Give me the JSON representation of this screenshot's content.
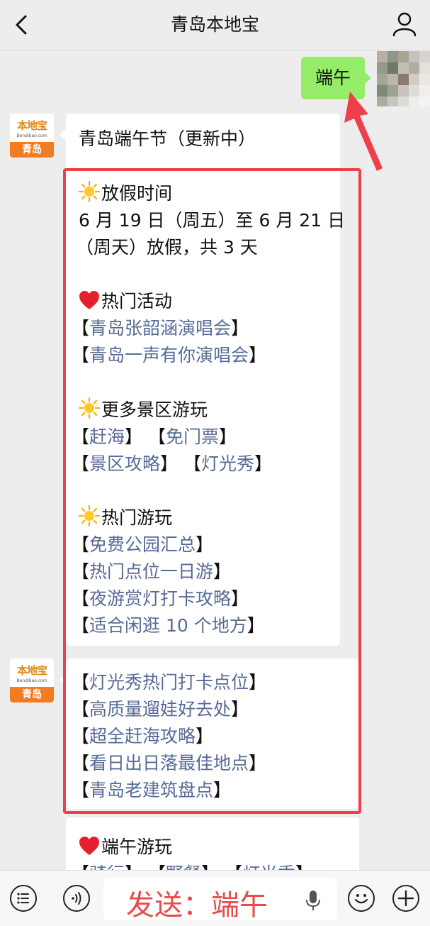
{
  "header": {
    "title": "青岛本地宝"
  },
  "sent_message": {
    "text": "端午"
  },
  "account": {
    "brand": "本地宝",
    "url": "Bendibao.com",
    "city": "青岛"
  },
  "message1": {
    "title": "青岛端午节（更新中）",
    "holiday_heading": "放假时间",
    "holiday_line1": "6 月 19 日（周五）至 6 月 21 日",
    "holiday_line2": "（周天）放假，共 3 天",
    "hot_events_heading": "热门活动",
    "hot_events": [
      "青岛张韶涵演唱会",
      "青岛一声有你演唱会"
    ],
    "scenic_heading": "更多景区游玩",
    "scenic_row1": [
      "赶海",
      "免门票"
    ],
    "scenic_row2": [
      "景区攻略",
      "灯光秀"
    ],
    "hot_play_heading": "热门游玩",
    "hot_play": [
      "免费公园汇总",
      "热门点位一日游",
      "夜游赏灯打卡攻略",
      "适合闲逛 10 个地方"
    ]
  },
  "message2": {
    "links": [
      "灯光秀热门打卡点位",
      "高质量遛娃好去处",
      "超全赶海攻略",
      "看日出日落最佳地点",
      "青岛老建筑盘点"
    ]
  },
  "message3": {
    "heading": "端午游玩",
    "row": [
      "骑行",
      "野餐",
      "灯光秀"
    ]
  },
  "input": {
    "hint": "发送：端午"
  },
  "colors": {
    "accent_red": "#ef3f4a",
    "bubble_green": "#95ec69",
    "link_blue": "#576b95"
  }
}
